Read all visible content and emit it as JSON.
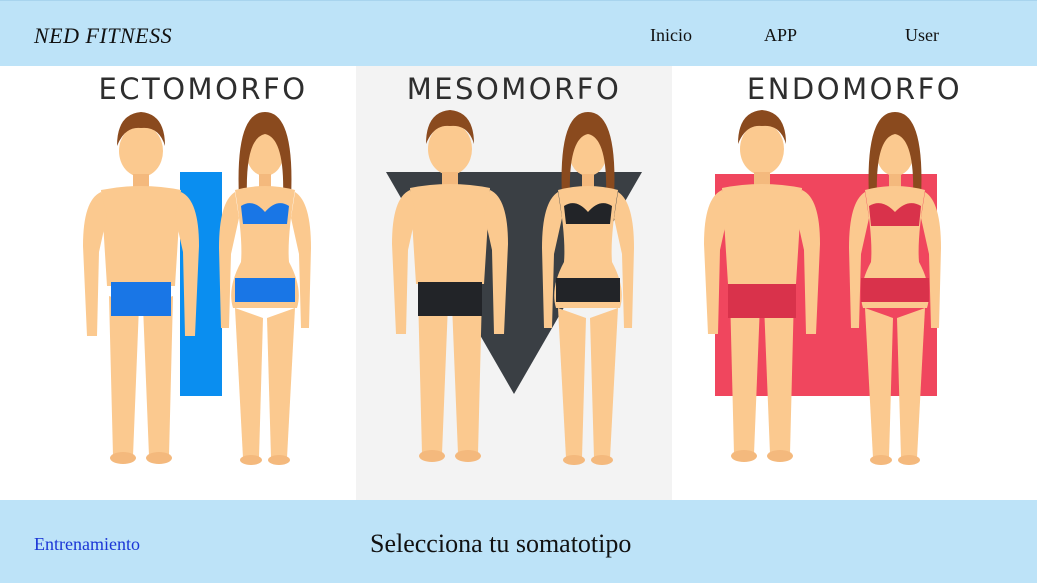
{
  "header": {
    "brand": "NED FITNESS",
    "nav": [
      "Inicio",
      "APP",
      "User"
    ]
  },
  "hero": {
    "panels": [
      {
        "title": "Ectomorfo",
        "shape": "rectangle-bar",
        "accent": "#0a8ef0"
      },
      {
        "title": "Mesomorfo",
        "shape": "inverted-triangle",
        "accent": "#3a3f44"
      },
      {
        "title": "Endomorfo",
        "shape": "square",
        "accent": "#f0465e"
      }
    ]
  },
  "footer": {
    "link": "Entrenamiento",
    "title": "Selecciona tu somatotipo"
  },
  "colors": {
    "bar": "#bde3f8",
    "skin": "#fbc98f",
    "hair": "#8a4a1e",
    "link": "#1b36d6"
  }
}
